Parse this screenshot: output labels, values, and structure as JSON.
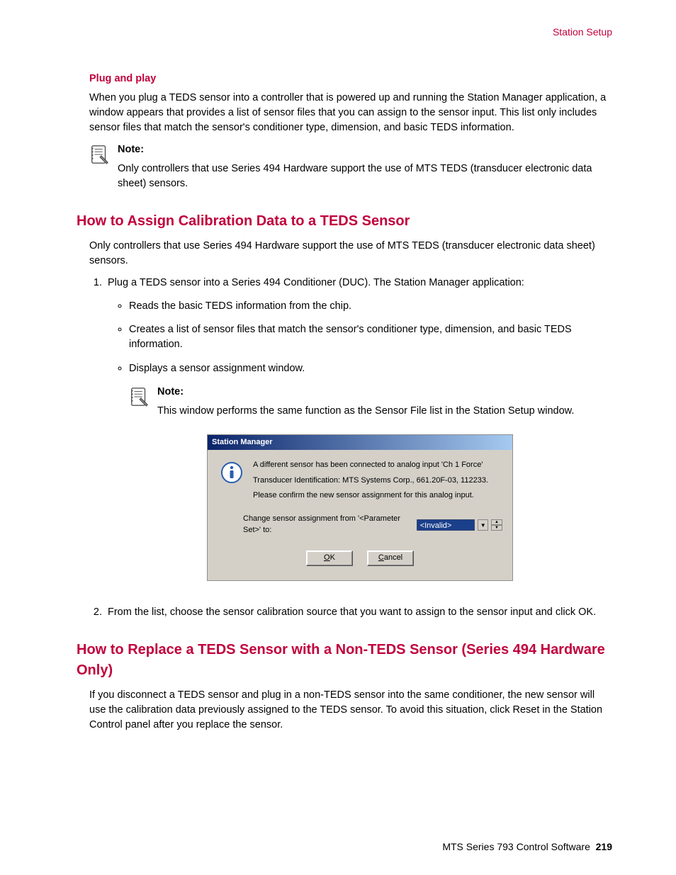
{
  "header": {
    "section": "Station Setup"
  },
  "plug_play": {
    "heading": "Plug and play",
    "para": "When you plug a TEDS sensor into a controller that is powered up and running the Station Manager application, a window appears that provides a list of sensor files that you can assign to the sensor input. This list only includes sensor files that match the sensor's conditioner type, dimension, and basic TEDS information.",
    "note_label": "Note:",
    "note_text": "Only controllers that use Series 494 Hardware support the use of MTS TEDS (transducer electronic data sheet) sensors."
  },
  "assign": {
    "heading": "How to Assign Calibration Data to a TEDS Sensor",
    "intro": "Only controllers that use Series 494 Hardware support the use of MTS TEDS (transducer electronic data sheet) sensors.",
    "step1": "Plug a TEDS sensor into a Series 494 Conditioner (DUC). The Station Manager application:",
    "bullets": [
      "Reads the basic TEDS information from the chip.",
      "Creates a list of sensor files that match the sensor's conditioner type, dimension, and basic TEDS information.",
      "Displays a sensor assignment window."
    ],
    "note_label": "Note:",
    "note_text": "This window performs the same function as the Sensor File list in the Station Setup window.",
    "step2": "From the list, choose the sensor calibration source that you want to assign to the sensor input and click OK."
  },
  "dialog": {
    "title": "Station Manager",
    "msg1": "A different sensor has been connected to analog input 'Ch 1 Force'",
    "msg2": "Transducer Identification: MTS Systems Corp., 661.20F-03, 112233.",
    "msg3": "Please confirm the new sensor assignment for this analog input.",
    "change_label": "Change sensor assignment from '<Parameter Set>' to:",
    "combo_value": "<Invalid>",
    "ok_prefix": "O",
    "ok_rest": "K",
    "cancel_prefix": "C",
    "cancel_rest": "ancel"
  },
  "replace": {
    "heading": "How to Replace a TEDS Sensor with a Non-TEDS Sensor (Series 494 Hardware Only)",
    "para": "If you disconnect a TEDS sensor and plug in a non-TEDS sensor into the same conditioner, the new sensor will use the calibration data previously assigned to the TEDS sensor. To avoid this situation, click Reset in the Station Control panel after you replace the sensor."
  },
  "footer": {
    "doc_title": "MTS Series 793 Control Software",
    "page_no": "219"
  }
}
